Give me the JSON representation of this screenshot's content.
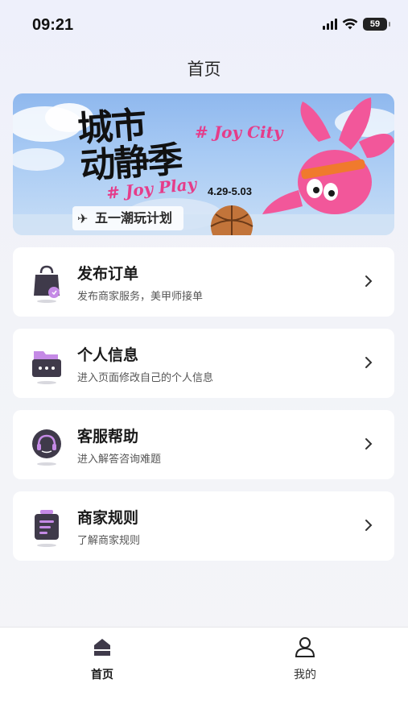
{
  "status_bar": {
    "time": "09:21",
    "battery": "59"
  },
  "header": {
    "title": "首页"
  },
  "banner": {
    "title_line1": "城市",
    "title_line2": "动静季",
    "tag_en1": "# Joy City",
    "tag_en2": "# Joy Play",
    "date_range": "4.29-5.03",
    "subtitle": "五一潮玩计划"
  },
  "menu": [
    {
      "title": "发布订单",
      "desc": "发布商家服务，美甲师接单",
      "icon": "shopping-bag-icon"
    },
    {
      "title": "个人信息",
      "desc": "进入页面修改自己的个人信息",
      "icon": "folder-icon"
    },
    {
      "title": "客服帮助",
      "desc": "进入解答咨询难题",
      "icon": "headset-icon"
    },
    {
      "title": "商家规则",
      "desc": "了解商家规则",
      "icon": "document-icon"
    }
  ],
  "tabbar": {
    "home": "首页",
    "mine": "我的"
  },
  "colors": {
    "accent_pink": "#e53d8a",
    "icon_dark": "#3f3a4a",
    "icon_purple": "#c58ae6"
  }
}
